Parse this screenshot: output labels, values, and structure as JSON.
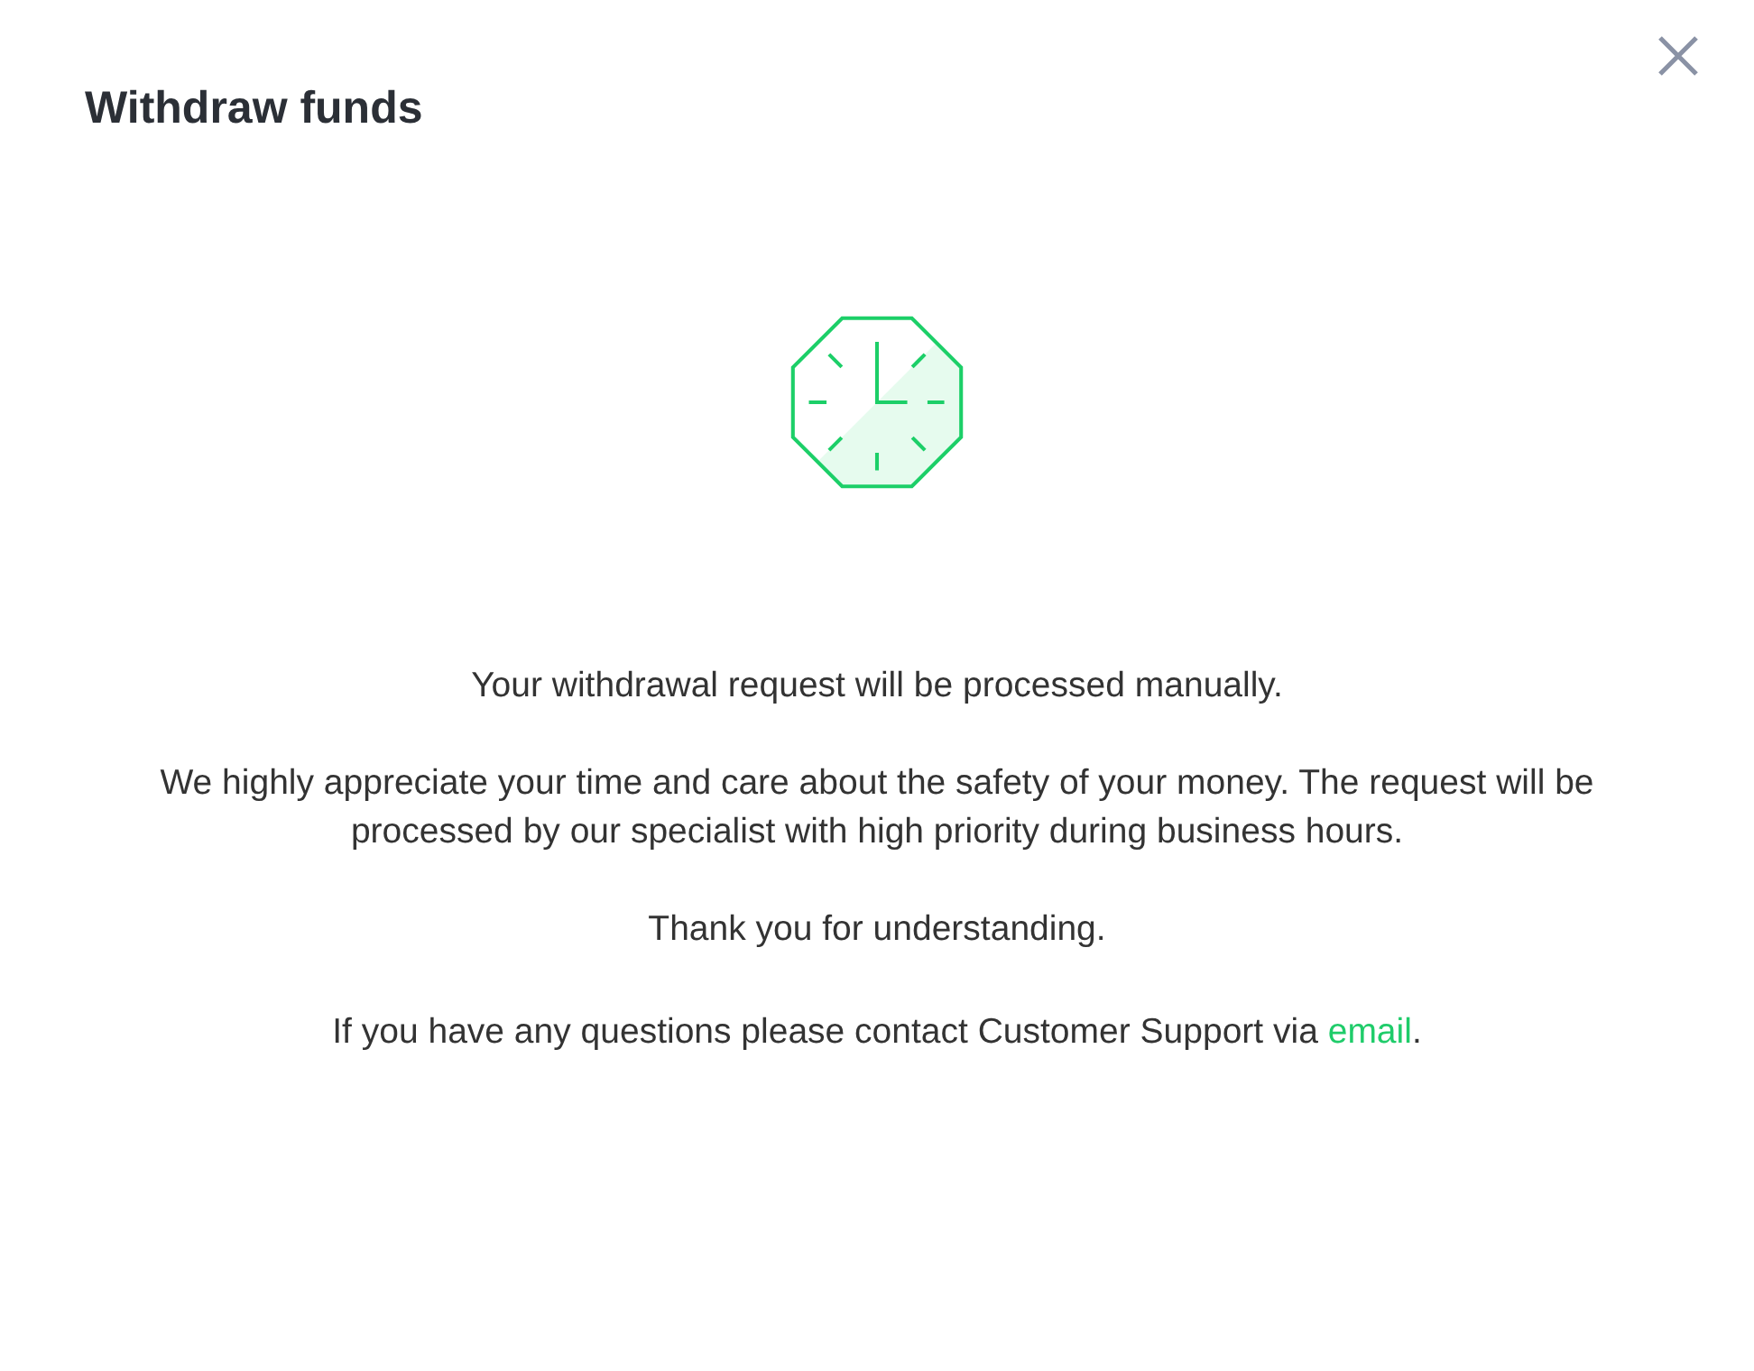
{
  "dialog": {
    "title": "Withdraw funds"
  },
  "message": {
    "paragraphs": [
      "Your withdrawal request will be processed manually.",
      "We highly appreciate your time and care about the safety of your money. The request will be processed by our specialist with high priority during business hours.",
      "Thank you for understanding."
    ],
    "support": {
      "text": "If you have any questions please contact Customer Support via",
      "link": "email",
      "after": "."
    }
  }
}
